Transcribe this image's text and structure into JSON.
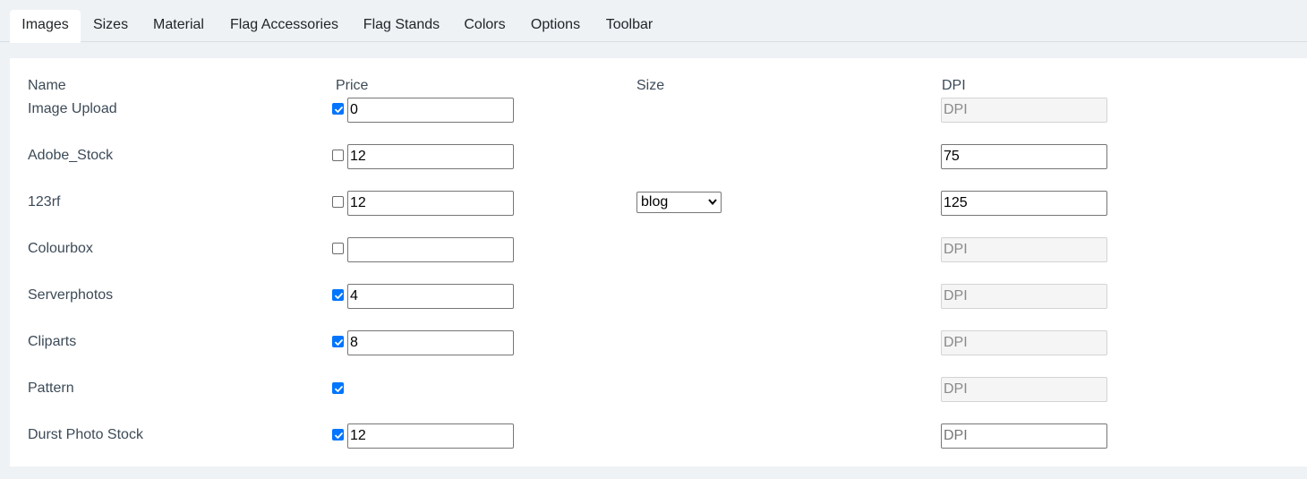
{
  "tabs": [
    {
      "label": "Images",
      "active": true
    },
    {
      "label": "Sizes"
    },
    {
      "label": "Material"
    },
    {
      "label": "Flag Accessories"
    },
    {
      "label": "Flag Stands"
    },
    {
      "label": "Colors"
    },
    {
      "label": "Options"
    },
    {
      "label": "Toolbar"
    }
  ],
  "table": {
    "headers": {
      "name": "Name",
      "price": "Price",
      "size": "Size",
      "dpi": "DPI"
    },
    "dpi_placeholder": "DPI",
    "rows": [
      {
        "name": "Image Upload",
        "checked": true,
        "price": "0",
        "dpi": "",
        "dpi_disabled": true
      },
      {
        "name": "Adobe_Stock",
        "checked": false,
        "price": "12",
        "dpi": "75",
        "dpi_disabled": false
      },
      {
        "name": "123rf",
        "checked": false,
        "price": "12",
        "size": "blog",
        "dpi": "125",
        "dpi_disabled": false
      },
      {
        "name": "Colourbox",
        "checked": false,
        "price": "",
        "dpi": "",
        "dpi_disabled": true
      },
      {
        "name": "Serverphotos",
        "checked": true,
        "price": "4",
        "dpi": "",
        "dpi_disabled": true
      },
      {
        "name": "Cliparts",
        "checked": true,
        "price": "8",
        "dpi": "",
        "dpi_disabled": true
      },
      {
        "name": "Pattern",
        "checked": true,
        "price": null,
        "dpi": "",
        "dpi_disabled": true
      },
      {
        "name": "Durst Photo Stock",
        "checked": true,
        "price": "12",
        "dpi": "",
        "dpi_disabled": false
      }
    ]
  },
  "colors": {
    "page_bg": "#eef2f5",
    "panel_bg": "#ffffff",
    "checkbox_accent": "#0075ff",
    "label_text": "#3c4a57"
  }
}
